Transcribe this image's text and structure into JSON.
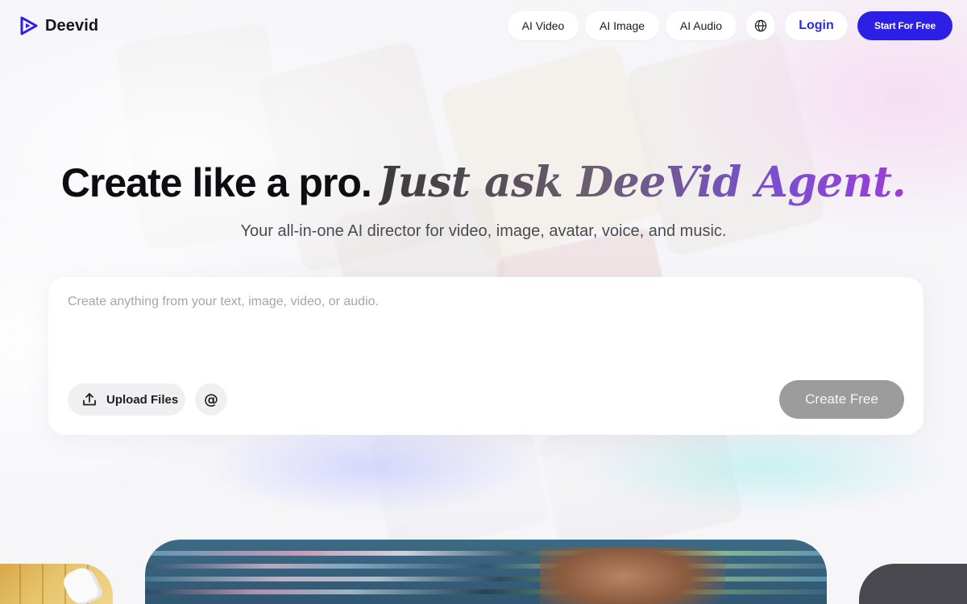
{
  "brand": {
    "name": "Deevid",
    "accent": "#2e1fe6"
  },
  "nav": {
    "items": [
      {
        "label": "AI Video"
      },
      {
        "label": "AI Image"
      },
      {
        "label": "AI Audio"
      }
    ],
    "language_icon": "globe-icon",
    "login_label": "Login",
    "cta_label": "Start For Free"
  },
  "hero": {
    "title_bold": "Create like a pro.",
    "title_script": "Just ask DeeVid Agent.",
    "subtitle": "Your all-in-one AI director for video, image, avatar, voice, and music."
  },
  "prompt": {
    "placeholder": "Create anything from your text, image, video, or audio.",
    "value": "",
    "upload_label": "Upload Files",
    "upload_icon": "upload-icon",
    "mention_icon": "at-sign-icon",
    "mention_glyph": "@",
    "submit_label": "Create Free"
  }
}
